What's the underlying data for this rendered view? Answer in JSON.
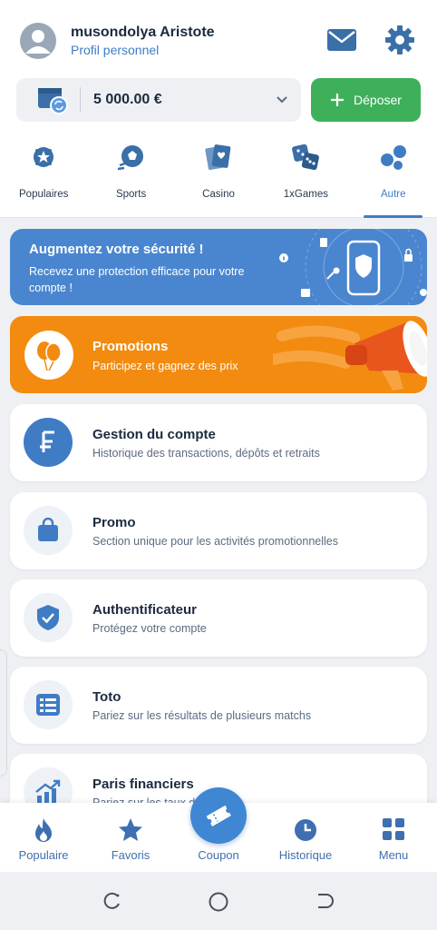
{
  "header": {
    "username": "musondolya Aristote",
    "profile_link": "Profil personnel",
    "balance": "5 000.00 €",
    "deposit_label": "Déposer"
  },
  "nav": {
    "items": [
      {
        "label": "Populaires",
        "icon": "star-badge-icon"
      },
      {
        "label": "Sports",
        "icon": "soccer-ball-icon"
      },
      {
        "label": "Casino",
        "icon": "cards-icon"
      },
      {
        "label": "1xGames",
        "icon": "dice-icon"
      },
      {
        "label": "Autre",
        "icon": "bubbles-icon"
      }
    ],
    "active": "Autre"
  },
  "security_banner": {
    "title": "Augmentez votre sécurité !",
    "subtitle": "Recevez une protection efficace pour votre compte !"
  },
  "promo_banner": {
    "title": "Promotions",
    "subtitle": "Participez et gagnez des prix"
  },
  "menu": {
    "items": [
      {
        "title": "Gestion du compte",
        "subtitle": "Historique des transactions, dépôts et retraits",
        "icon": "currency-icon"
      },
      {
        "title": "Promo",
        "subtitle": "Section unique pour les activités promotionnelles",
        "icon": "shopping-bag-icon"
      },
      {
        "title": "Authentificateur",
        "subtitle": "Protégez votre compte",
        "icon": "shield-check-icon"
      },
      {
        "title": "Toto",
        "subtitle": "Pariez sur les résultats de plusieurs matchs",
        "icon": "list-icon"
      },
      {
        "title": "Paris financiers",
        "subtitle": "Pariez sur les taux de change",
        "icon": "chart-up-icon"
      }
    ]
  },
  "bottom_nav": {
    "items": [
      {
        "label": "Populaire",
        "icon": "flame-icon"
      },
      {
        "label": "Favoris",
        "icon": "star-icon"
      },
      {
        "label": "Coupon",
        "icon": "ticket-icon"
      },
      {
        "label": "Historique",
        "icon": "clock-icon"
      },
      {
        "label": "Menu",
        "icon": "grid-icon"
      }
    ]
  },
  "colors": {
    "accent": "#3f7cc4",
    "deposit_green": "#3eb05a",
    "security_blue": "#4a86cf",
    "promo_orange": "#f28b10"
  }
}
